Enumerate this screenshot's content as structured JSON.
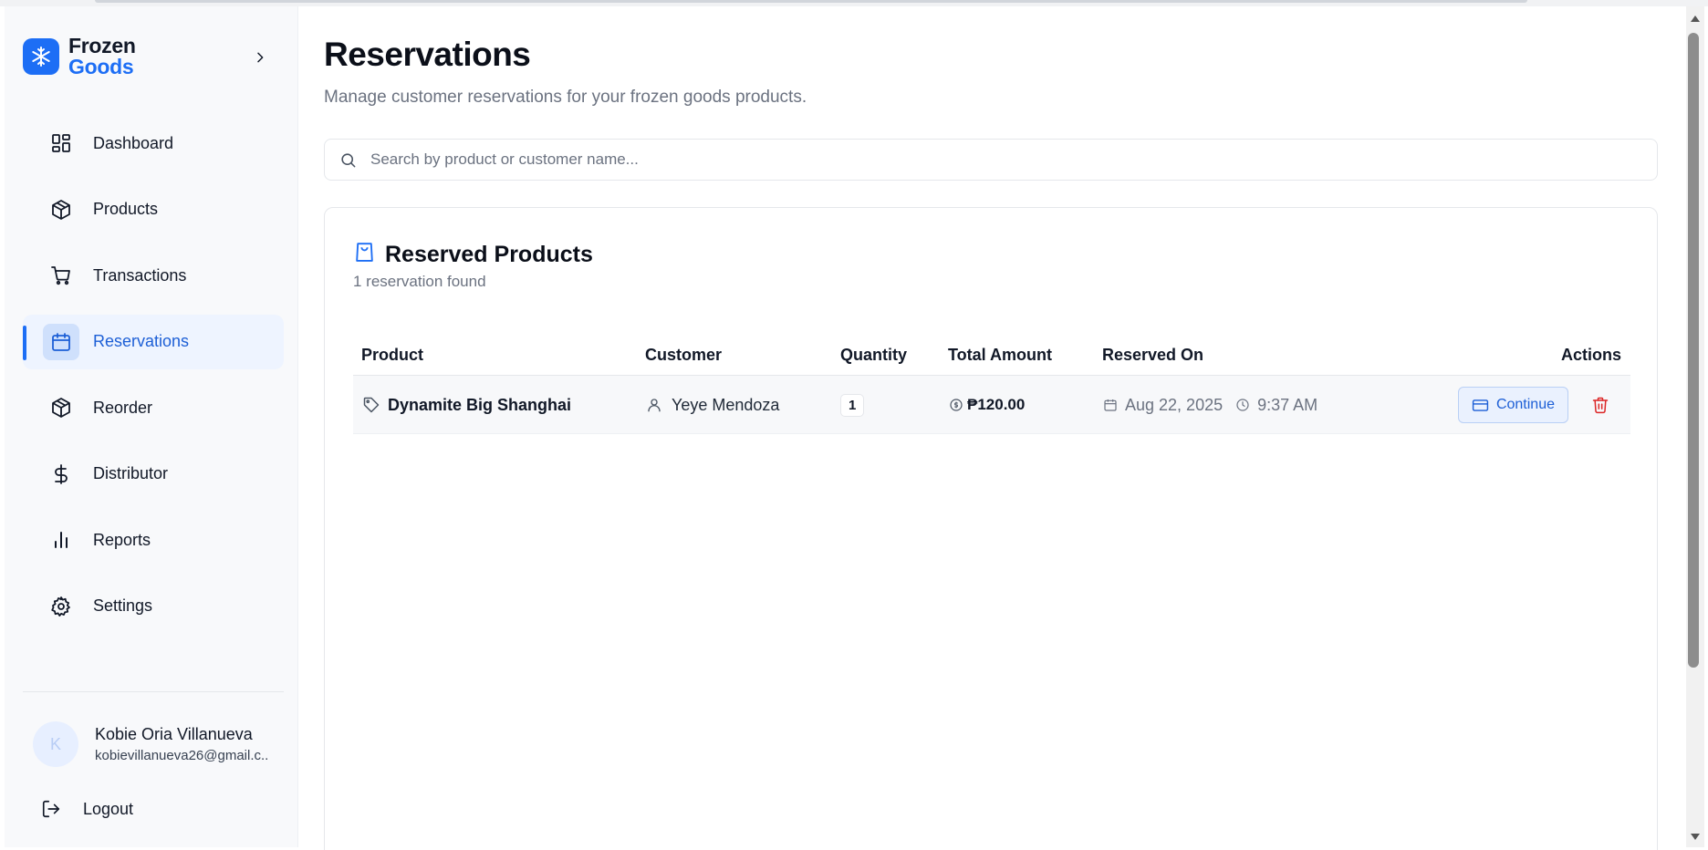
{
  "brand": {
    "line1": "Frozen",
    "line2": "Goods",
    "accent": "#1d6ef5"
  },
  "sidebar": {
    "items": [
      {
        "label": "Dashboard",
        "icon": "dashboard-icon"
      },
      {
        "label": "Products",
        "icon": "package-icon"
      },
      {
        "label": "Transactions",
        "icon": "cart-icon"
      },
      {
        "label": "Reservations",
        "icon": "calendar-icon",
        "active": true
      },
      {
        "label": "Reorder",
        "icon": "package-icon"
      },
      {
        "label": "Distributor",
        "icon": "dollar-icon"
      },
      {
        "label": "Reports",
        "icon": "bar-chart-icon"
      },
      {
        "label": "Settings",
        "icon": "gear-icon"
      }
    ]
  },
  "user": {
    "initial": "K",
    "name": "Kobie Oria Villanueva",
    "email": "kobievillanueva26@gmail.c..."
  },
  "logout_label": "Logout",
  "page": {
    "title": "Reservations",
    "subtitle": "Manage customer reservations for your frozen goods products."
  },
  "search": {
    "placeholder": "Search by product or customer name...",
    "value": ""
  },
  "card": {
    "title": "Reserved Products",
    "count_text": "1 reservation found"
  },
  "table": {
    "headers": {
      "product": "Product",
      "customer": "Customer",
      "quantity": "Quantity",
      "total": "Total Amount",
      "reserved_on": "Reserved On",
      "actions": "Actions"
    },
    "rows": [
      {
        "product": "Dynamite Big Shanghai",
        "customer": "Yeye Mendoza",
        "quantity": "1",
        "total": "₱120.00",
        "date": "Aug 22, 2025",
        "time": "9:37 AM",
        "continue_label": "Continue"
      }
    ]
  },
  "colors": {
    "danger": "#dc2626",
    "active_bg": "#eef4ff"
  }
}
